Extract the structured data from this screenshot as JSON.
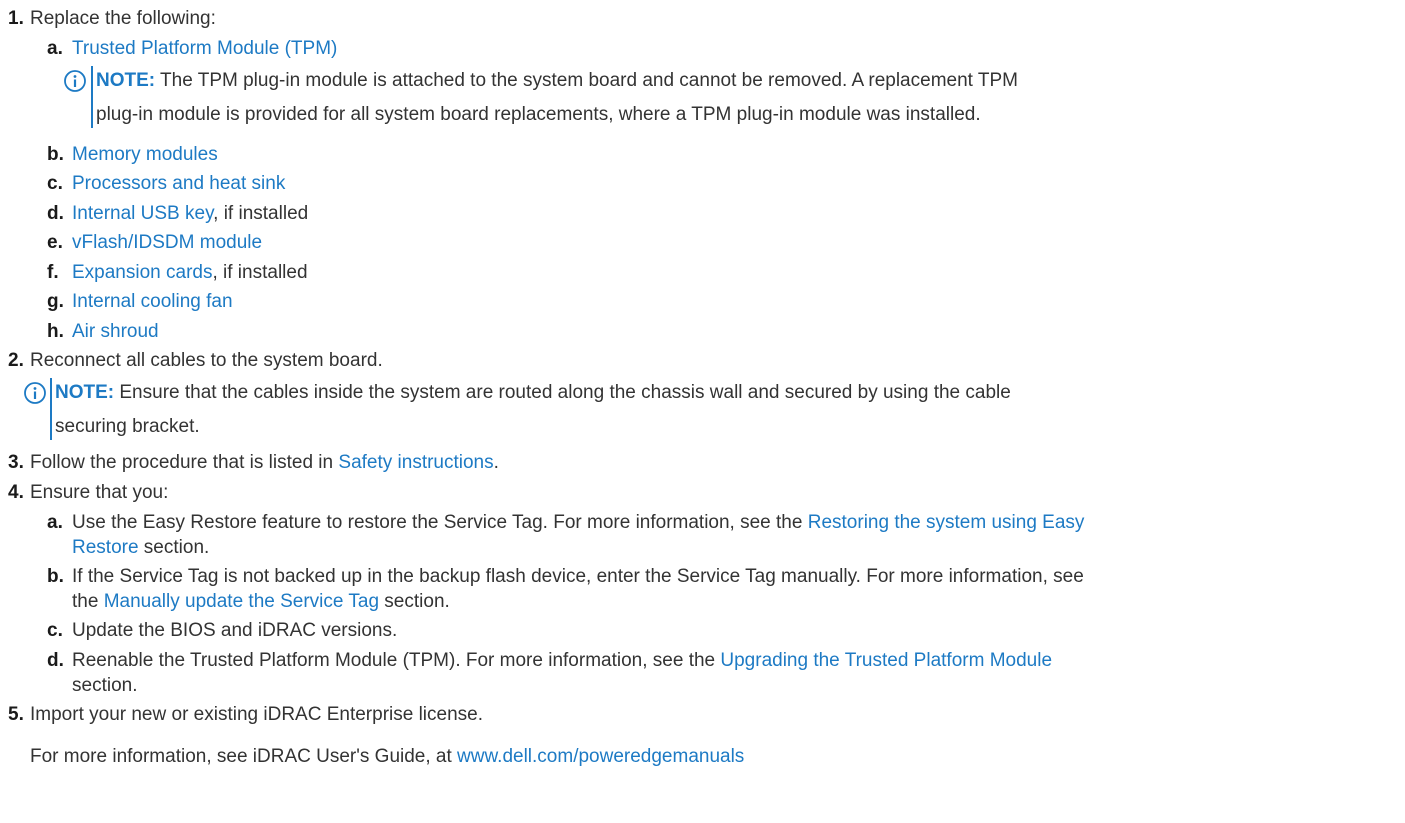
{
  "steps": [
    {
      "num": "1.",
      "text": "Replace the following:",
      "subs": [
        {
          "letter": "a.",
          "link": "Trusted Platform Module (TPM)"
        },
        {
          "letter": "b.",
          "link": "Memory modules"
        },
        {
          "letter": "c.",
          "link": "Processors and heat sink"
        },
        {
          "letter": "d.",
          "link": "Internal USB key",
          "suffix": ", if installed"
        },
        {
          "letter": "e.",
          "link": "vFlash/IDSDM module"
        },
        {
          "letter": "f.",
          "link": "Expansion cards",
          "suffix": ", if installed"
        },
        {
          "letter": "g.",
          "link": "Internal cooling fan"
        },
        {
          "letter": "h.",
          "link": "Air shroud"
        }
      ],
      "note": {
        "label": "NOTE:",
        "line1": " The TPM plug-in module is attached to the system board and cannot be removed. A replacement TPM",
        "line2": "plug-in module is provided for all system board replacements, where a TPM plug-in module was installed."
      }
    },
    {
      "num": "2.",
      "text": "Reconnect all cables to the system board.",
      "note": {
        "label": "NOTE:",
        "line1": " Ensure that the cables inside the system are routed along the chassis wall and secured by using the cable",
        "line2": "securing bracket."
      }
    },
    {
      "num": "3.",
      "text_before": "Follow the procedure that is listed in ",
      "link": "Safety instructions",
      "text_after": "."
    },
    {
      "num": "4.",
      "text": "Ensure that you:",
      "subs": [
        {
          "letter": "a.",
          "line1_text": "Use the Easy Restore feature to restore the Service Tag. For more information, see the ",
          "line1_link": "Restoring the system using Easy",
          "line2_link": "Restore",
          "line2_text": " section."
        },
        {
          "letter": "b.",
          "line1_text": "If the Service Tag is not backed up in the backup flash device, enter the Service Tag manually. For more information, see",
          "line2_text_before": "the ",
          "line2_link": "Manually update the Service Tag",
          "line2_text_after": " section."
        },
        {
          "letter": "c.",
          "text": "Update the BIOS and iDRAC versions."
        },
        {
          "letter": "d.",
          "line1_text": "Reenable the Trusted Platform Module (TPM). For more information, see the ",
          "line1_link": "Upgrading the Trusted Platform Module",
          "line2_text": "section."
        }
      ]
    },
    {
      "num": "5.",
      "text": "Import your new or existing iDRAC Enterprise license.",
      "para_text": "For more information, see iDRAC User's Guide, at ",
      "para_link": "www.dell.com/poweredgemanuals"
    }
  ],
  "icons": {
    "note": "info-circle-icon"
  },
  "colors": {
    "link": "#1d7ac4",
    "text": "#333333"
  }
}
